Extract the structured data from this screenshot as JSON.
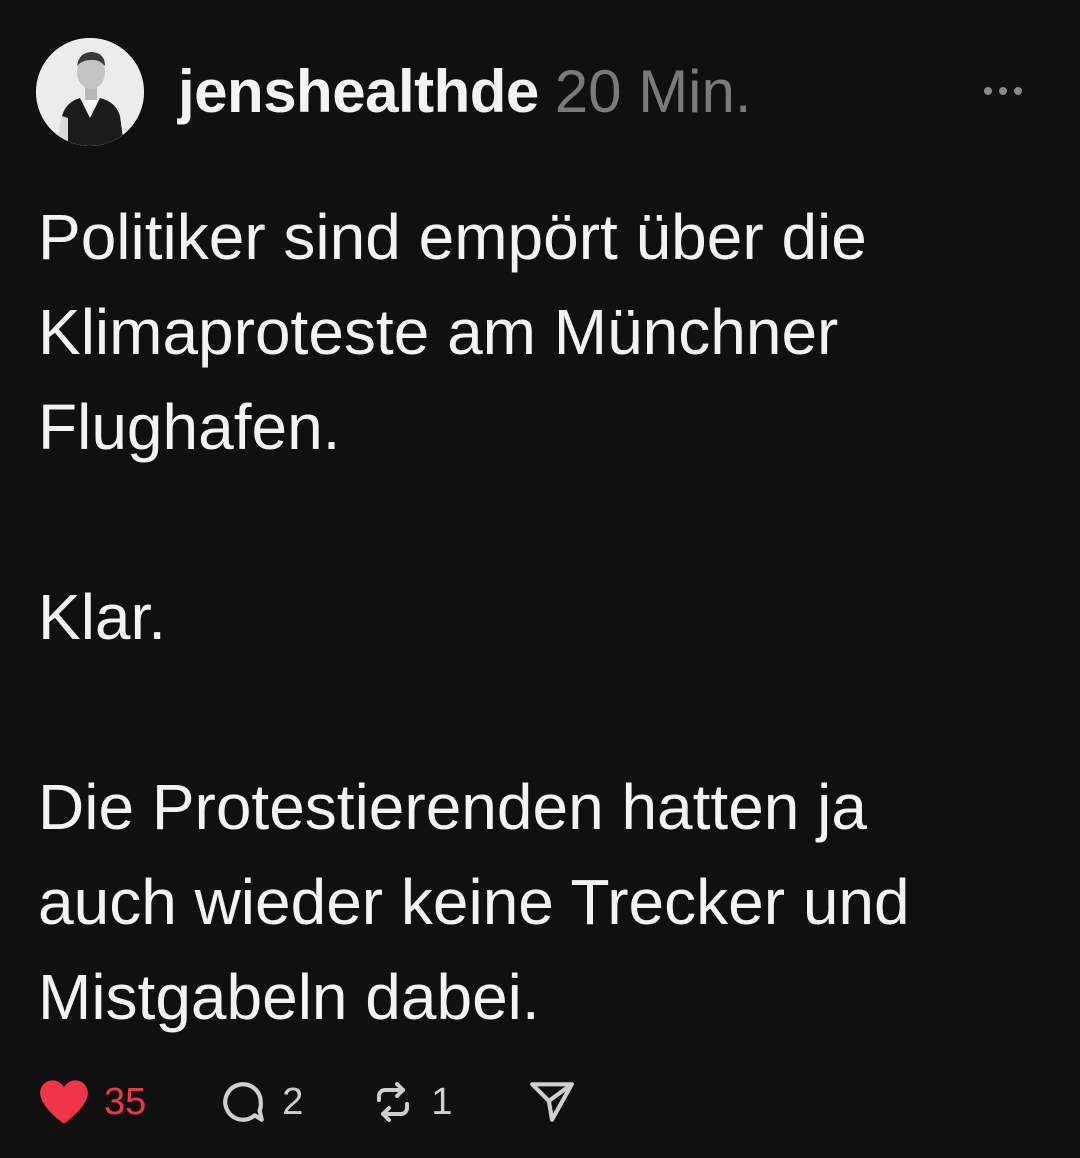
{
  "post": {
    "username": "jenshealthde",
    "time": "20 Min.",
    "more_icon": "more-horizontal-icon",
    "lines": [
      "Politiker sind empört über die",
      "Klimaproteste am Münchner",
      "Flughafen.",
      "",
      "Klar.",
      "",
      "Die Protestierenden hatten ja",
      "auch wieder keine Trecker und",
      "Mistgabeln dabei."
    ]
  },
  "actions": {
    "likes": "35",
    "replies": "2",
    "reposts": "1",
    "like_color": "#f0354a"
  },
  "colors": {
    "background": "#101010",
    "text": "#f3f3f3",
    "muted": "#7a7a7a",
    "like": "#f0354a"
  }
}
